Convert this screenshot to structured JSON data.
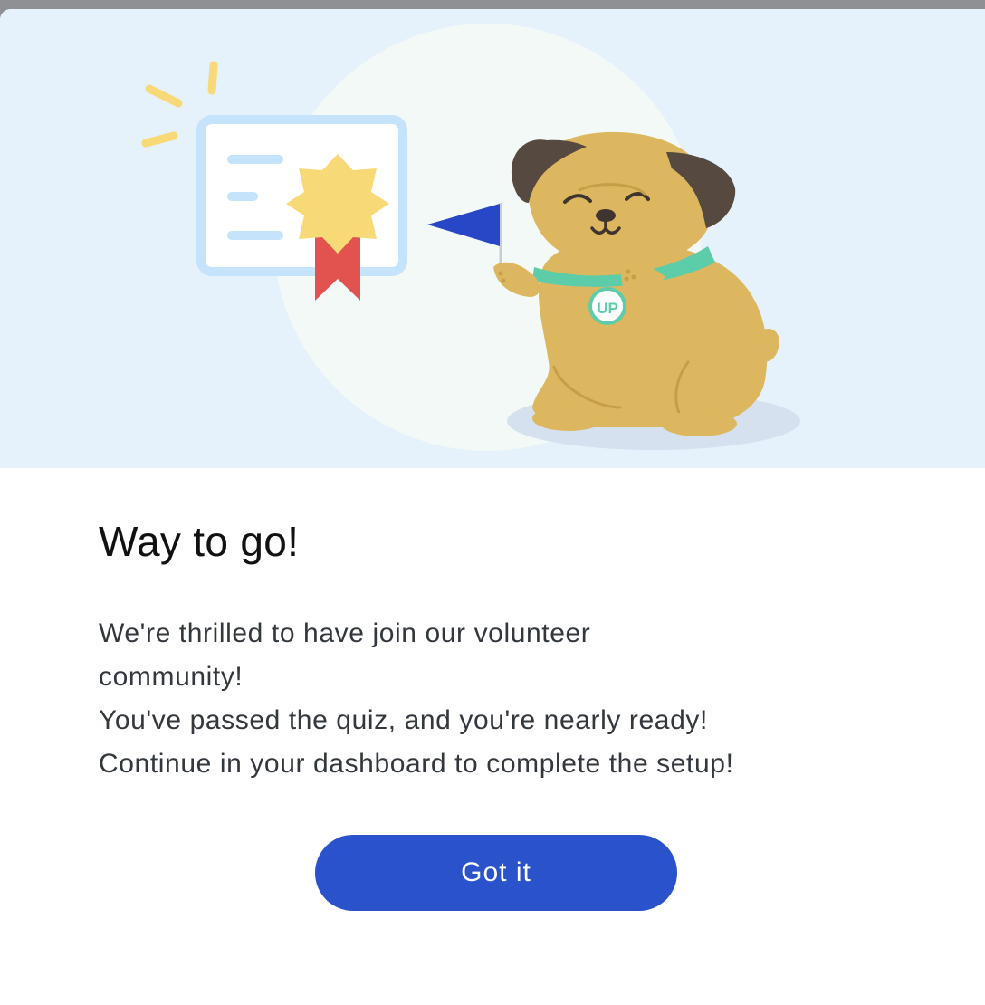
{
  "dialog": {
    "title": "Way to go!",
    "paragraphs": [
      "We're thrilled to have join our volunteer community!",
      "You've passed the quiz, and you're nearly ready!",
      "Continue in your dashboard to complete the setup!"
    ],
    "button_label": "Got it"
  },
  "illustration": {
    "badge_text": "UP",
    "icons": [
      "certificate-icon",
      "award-star-icon",
      "ribbon-icon",
      "flag-icon",
      "pug-mascot",
      "sparkle-icon"
    ]
  },
  "colors": {
    "hero_background": "#e5f1fb",
    "primary_button": "#2a52cb",
    "mascot_fur": "#ddb75f",
    "collar": "#5dcca8",
    "flag": "#2747c7",
    "star": "#f8d978",
    "ribbon": "#e2534f"
  }
}
